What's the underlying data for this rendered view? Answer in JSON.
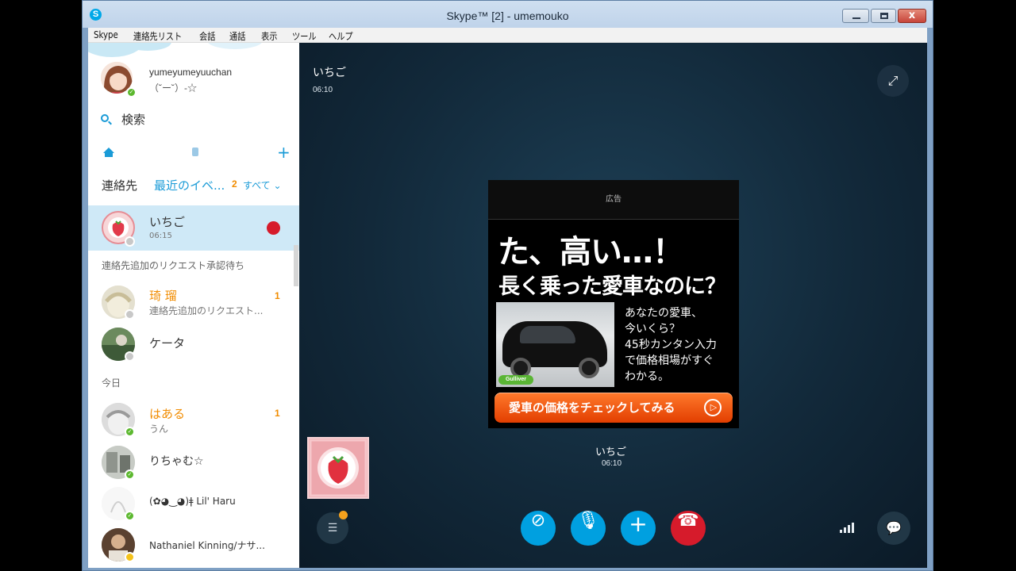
{
  "window": {
    "title": "Skype™ [2] - umemouko",
    "app_icon": "S",
    "close_glyph": "x",
    "menu": [
      "Skype",
      "連絡先リスト",
      "会話",
      "通話",
      "表示",
      "ツール",
      "ヘルプ"
    ]
  },
  "sidebar": {
    "profile": {
      "username": "yumeyumeyuuchan",
      "mood": "（˘ー˘）-☆"
    },
    "search_label": "検索",
    "plus_glyph": "+",
    "tabs": {
      "contacts": "連絡先",
      "recent": "最近のイベ...",
      "count": "2",
      "all": "すべて ⌄"
    },
    "sections": {
      "pending": "連絡先追加のリクエスト承認待ち",
      "today": "今日"
    },
    "active_call": {
      "name": "いちご",
      "time": "06:15"
    },
    "pending_contacts": [
      {
        "name": "琦 瑠",
        "sub": "連絡先追加のリクエスト...",
        "badge": "1"
      },
      {
        "name": "ケータ",
        "sub": "",
        "badge": ""
      }
    ],
    "today_contacts": [
      {
        "name": "はある",
        "sub": "うん",
        "badge": "1"
      },
      {
        "name": "りちゃむ☆",
        "sub": "",
        "badge": ""
      },
      {
        "name": "(✿◕‿◕)ǂ Lil' Haru",
        "sub": "",
        "badge": ""
      },
      {
        "name": "Nathaniel Kinning/ナサ...",
        "sub": "",
        "badge": ""
      }
    ]
  },
  "call": {
    "caller_name": "いちご",
    "caller_time": "06:10",
    "callee_name": "いちご",
    "callee_time": "06:10"
  },
  "ad": {
    "label": "広告",
    "headline1": "た、高い…！",
    "headline2": "長く乗った愛車なのに？",
    "body_lines": [
      "あなたの愛車、",
      "今いくら？",
      "45秒カンタン入力",
      "で価格相場がすぐ",
      "わかる。"
    ],
    "logo_text": "Gulliver",
    "cta": "愛車の価格をチェックしてみる",
    "cta_glyph": "▷"
  },
  "icons": {
    "fullscreen": "fullscreen-icon",
    "video_off": "video-off-icon",
    "mic": "microphone-icon",
    "add": "plus-icon",
    "hangup": "hang-up-icon",
    "list": "list-icon",
    "signal": "signal-strength-icon",
    "chat": "chat-icon"
  },
  "glyphs": {
    "fullscreen": "⤢",
    "video_off": "⊘",
    "mic": "🎙",
    "add": "+",
    "hangup": "☎",
    "list": "☰",
    "chat": "💬"
  },
  "colors": {
    "skype_blue": "#00a0e0",
    "hangup_red": "#d61b2b",
    "badge_orange": "#f18c00",
    "ad_cta": "#e84a0c"
  }
}
